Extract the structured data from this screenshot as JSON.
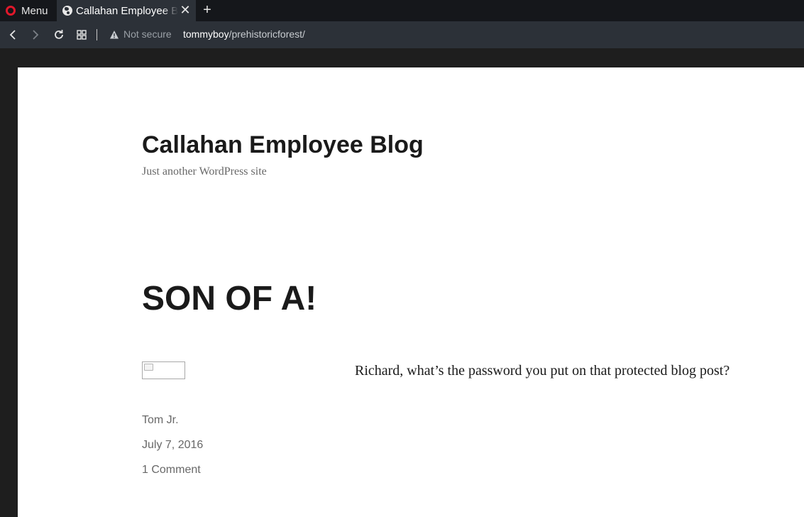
{
  "browser": {
    "menu_label": "Menu",
    "tab_title": "Callahan Employee Blog",
    "security_label": "Not secure",
    "url_host": "tommyboy",
    "url_path": "/prehistoricforest/"
  },
  "site": {
    "title": "Callahan Employee Blog",
    "description": "Just another WordPress site"
  },
  "post": {
    "title": "SON OF A!",
    "body": "Richard, what’s the password you put on that protected blog post?",
    "author": "Tom Jr.",
    "date": "July 7, 2016",
    "comments": "1 Comment"
  },
  "icons": {
    "browser_logo": "opera-icon",
    "tab_favicon": "globe-icon",
    "tab_close": "close-icon",
    "new_tab": "plus-icon",
    "back": "back-icon",
    "forward": "forward-icon",
    "reload": "reload-icon",
    "speed_dial": "grid-icon",
    "warning": "warning-icon"
  },
  "colors": {
    "tab_strip": "#15171b",
    "toolbar": "#2c3138",
    "opera_red": "#e0182b",
    "page_background": "#ffffff",
    "heading_text": "#1a1a1a",
    "meta_text": "#686868"
  }
}
